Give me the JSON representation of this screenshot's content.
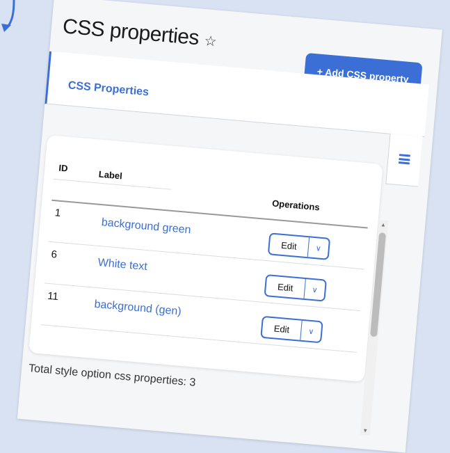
{
  "page": {
    "title": "CSS properties",
    "add_button": "+ Add CSS property"
  },
  "tabs": [
    {
      "label": "CSS Properties"
    }
  ],
  "table": {
    "headers": {
      "id": "ID",
      "label": "Label",
      "operations": "Operations"
    },
    "rows": [
      {
        "id": "1",
        "label": "background green",
        "edit": "Edit"
      },
      {
        "id": "6",
        "label": "White text",
        "edit": "Edit"
      },
      {
        "id": "11",
        "label": "background (gen)",
        "edit": "Edit"
      }
    ]
  },
  "footer": "Total style option css properties: 3",
  "icons": {
    "favorite": "star-icon",
    "menu": "hamburger-menu-icon",
    "dropdown": "chevron-down-icon",
    "arrow": "curved-arrow-icon"
  },
  "colors": {
    "accent": "#3b6fd6",
    "background": "#d9e2f3"
  }
}
